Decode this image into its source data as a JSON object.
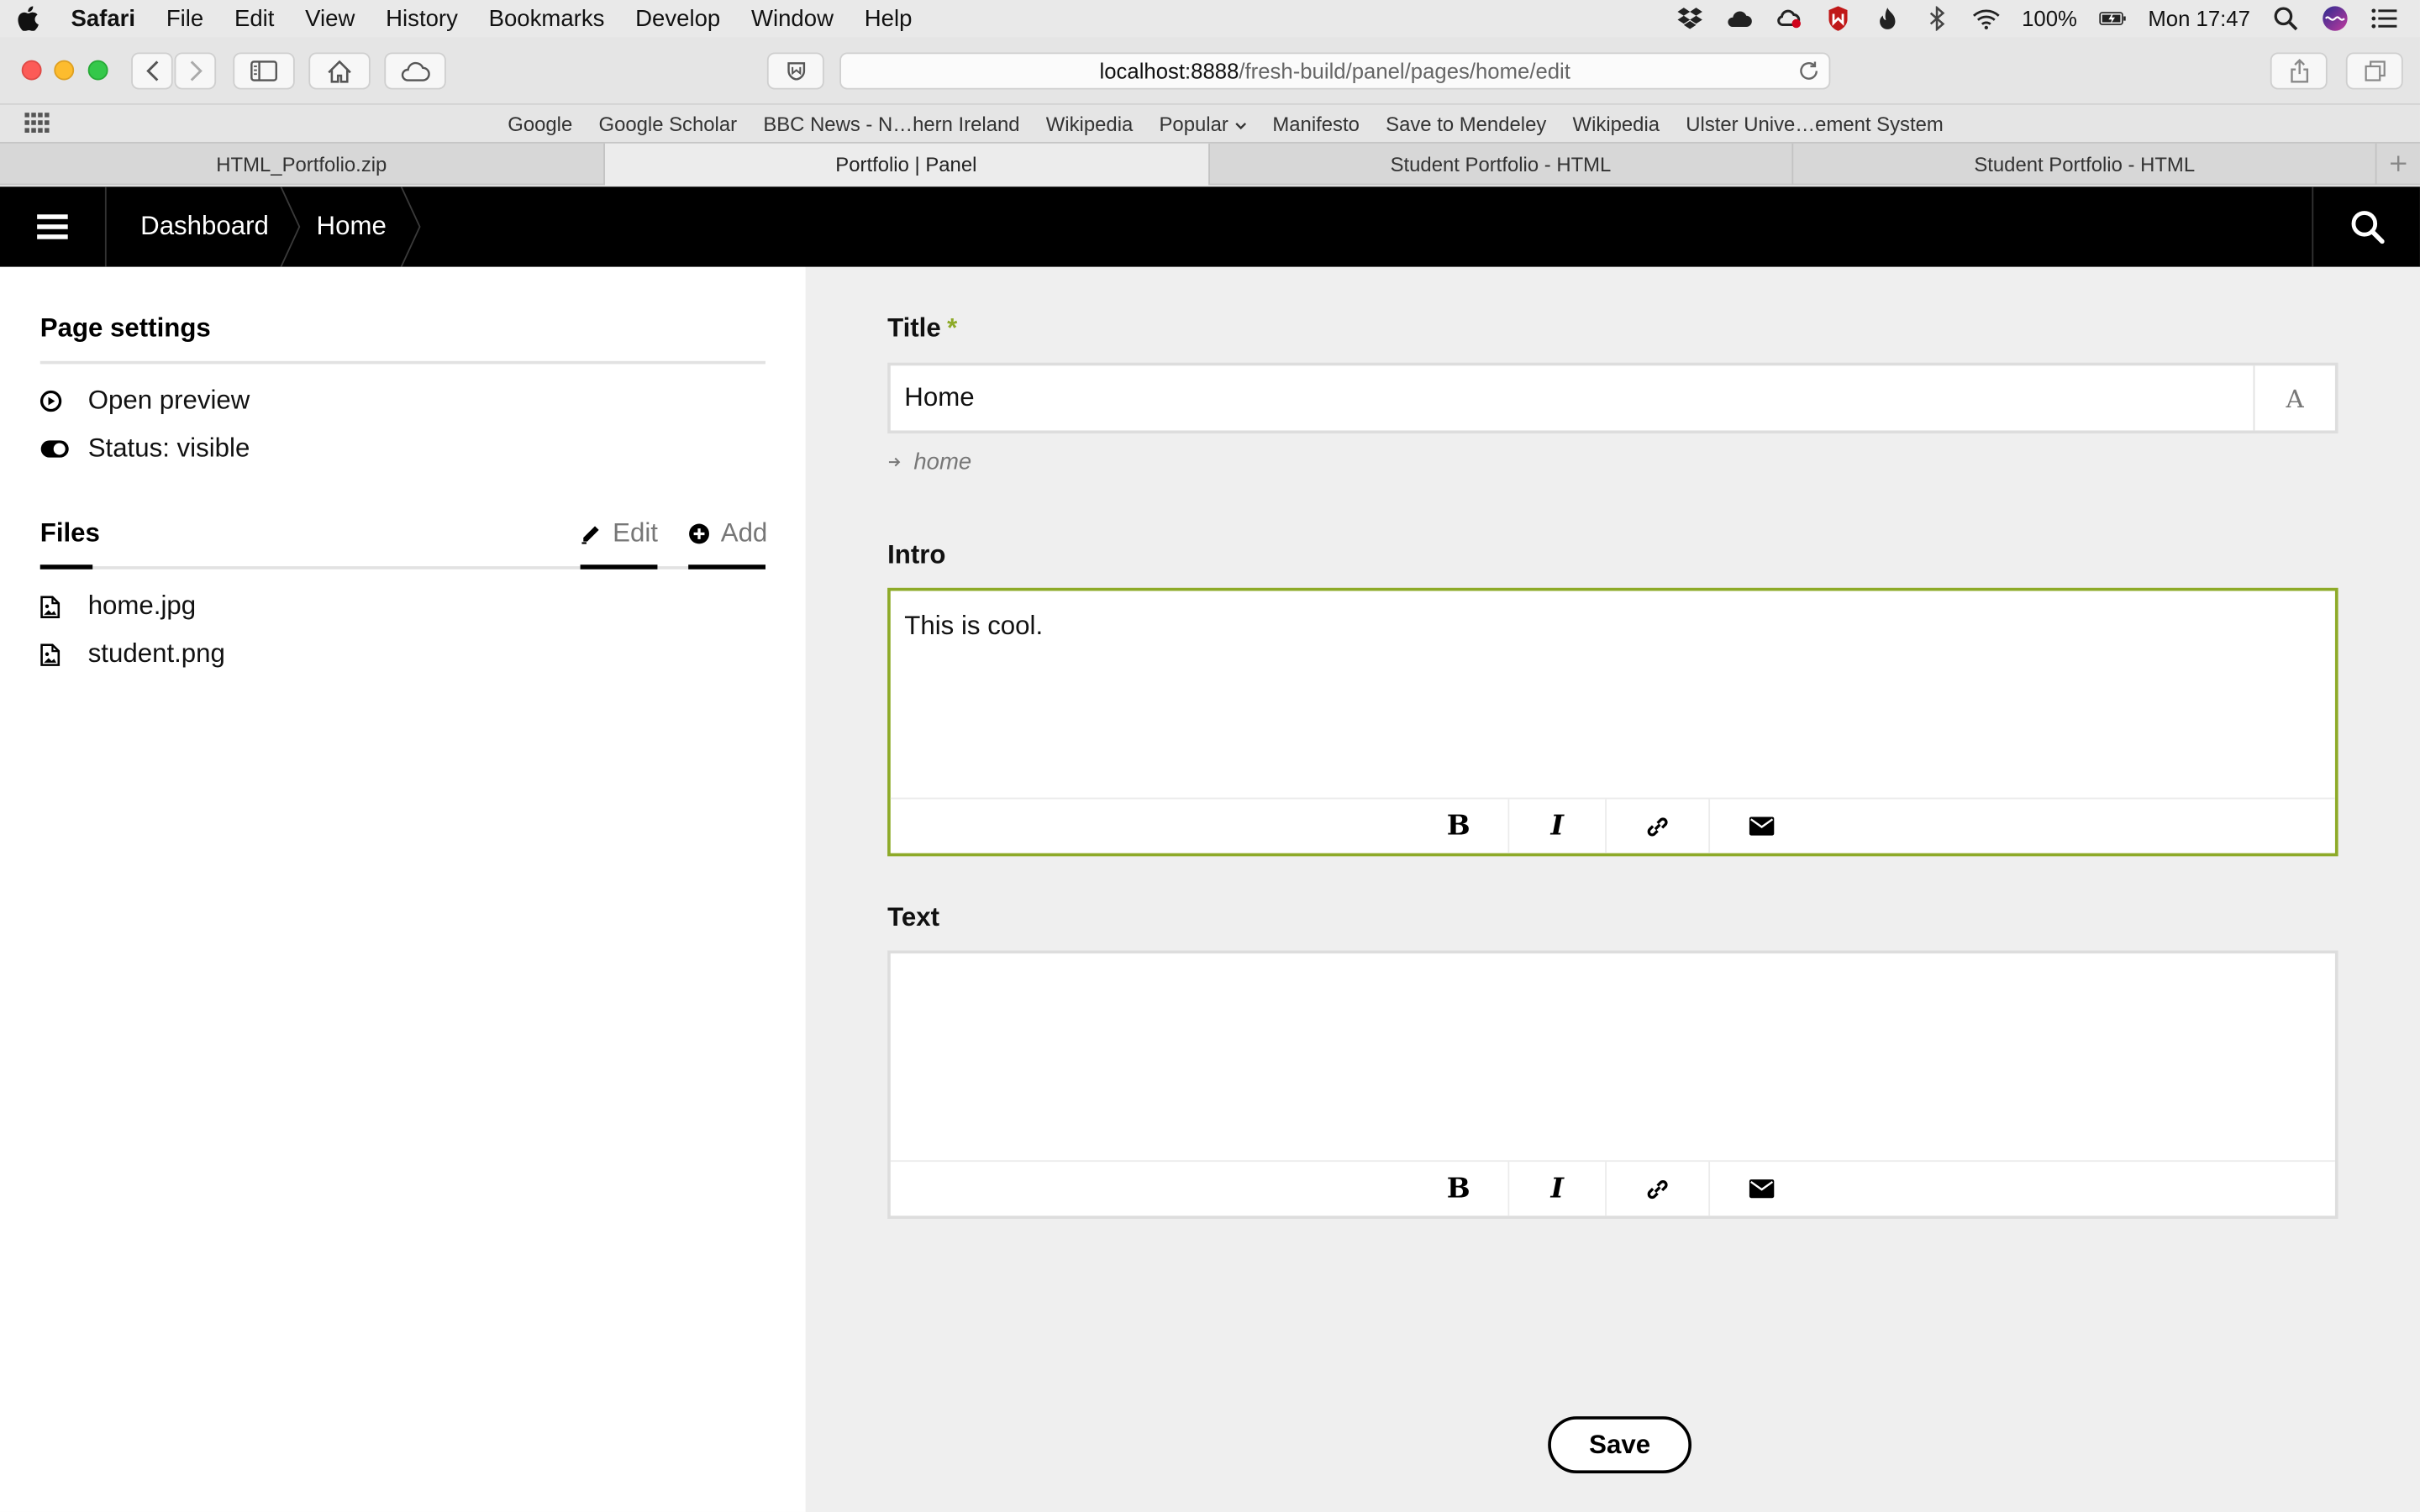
{
  "menubar": {
    "app": "Safari",
    "items": [
      "File",
      "Edit",
      "View",
      "History",
      "Bookmarks",
      "Develop",
      "Window",
      "Help"
    ],
    "battery": "100%",
    "clock": "Mon 17:47",
    "icons": [
      "dropbox-icon",
      "cloud-icon",
      "creative-cloud-icon",
      "mcafee-icon",
      "flame-icon",
      "bluetooth-icon",
      "wifi-icon",
      "battery-icon",
      "spotlight-icon",
      "siri-icon",
      "list-icon"
    ]
  },
  "browser": {
    "url_host": "localhost:8888",
    "url_path": "/fresh-build/panel/pages/home/edit",
    "bookmarks": [
      "Google",
      "Google Scholar",
      "BBC News - N…hern Ireland",
      "Wikipedia",
      "Popular",
      "Manifesto",
      "Save to Mendeley",
      "Wikipedia",
      "Ulster Unive…ement System"
    ],
    "tabs": [
      {
        "label": "HTML_Portfolio.zip",
        "active": false
      },
      {
        "label": "Portfolio | Panel",
        "active": true
      },
      {
        "label": "Student Portfolio - HTML",
        "active": false
      },
      {
        "label": "Student Portfolio - HTML",
        "active": false
      }
    ]
  },
  "topbar": {
    "breadcrumbs": [
      "Dashboard",
      "Home"
    ]
  },
  "sidebar": {
    "page_settings_title": "Page settings",
    "open_preview": "Open preview",
    "status": "Status: visible",
    "files_title": "Files",
    "edit_label": "Edit",
    "add_label": "Add",
    "files": [
      "home.jpg",
      "student.png"
    ]
  },
  "form": {
    "title_label": "Title",
    "required_mark": "*",
    "title_value": "Home",
    "title_addon": "A",
    "slug": "home",
    "intro_label": "Intro",
    "intro_value": "This is cool.",
    "text_label": "Text",
    "text_value": "",
    "editor_buttons": [
      "B",
      "I"
    ],
    "save_label": "Save"
  },
  "colors": {
    "accent": "#8daa28",
    "topbar": "#000000",
    "sidebar": "#ffffff",
    "main_bg": "#efefef"
  }
}
